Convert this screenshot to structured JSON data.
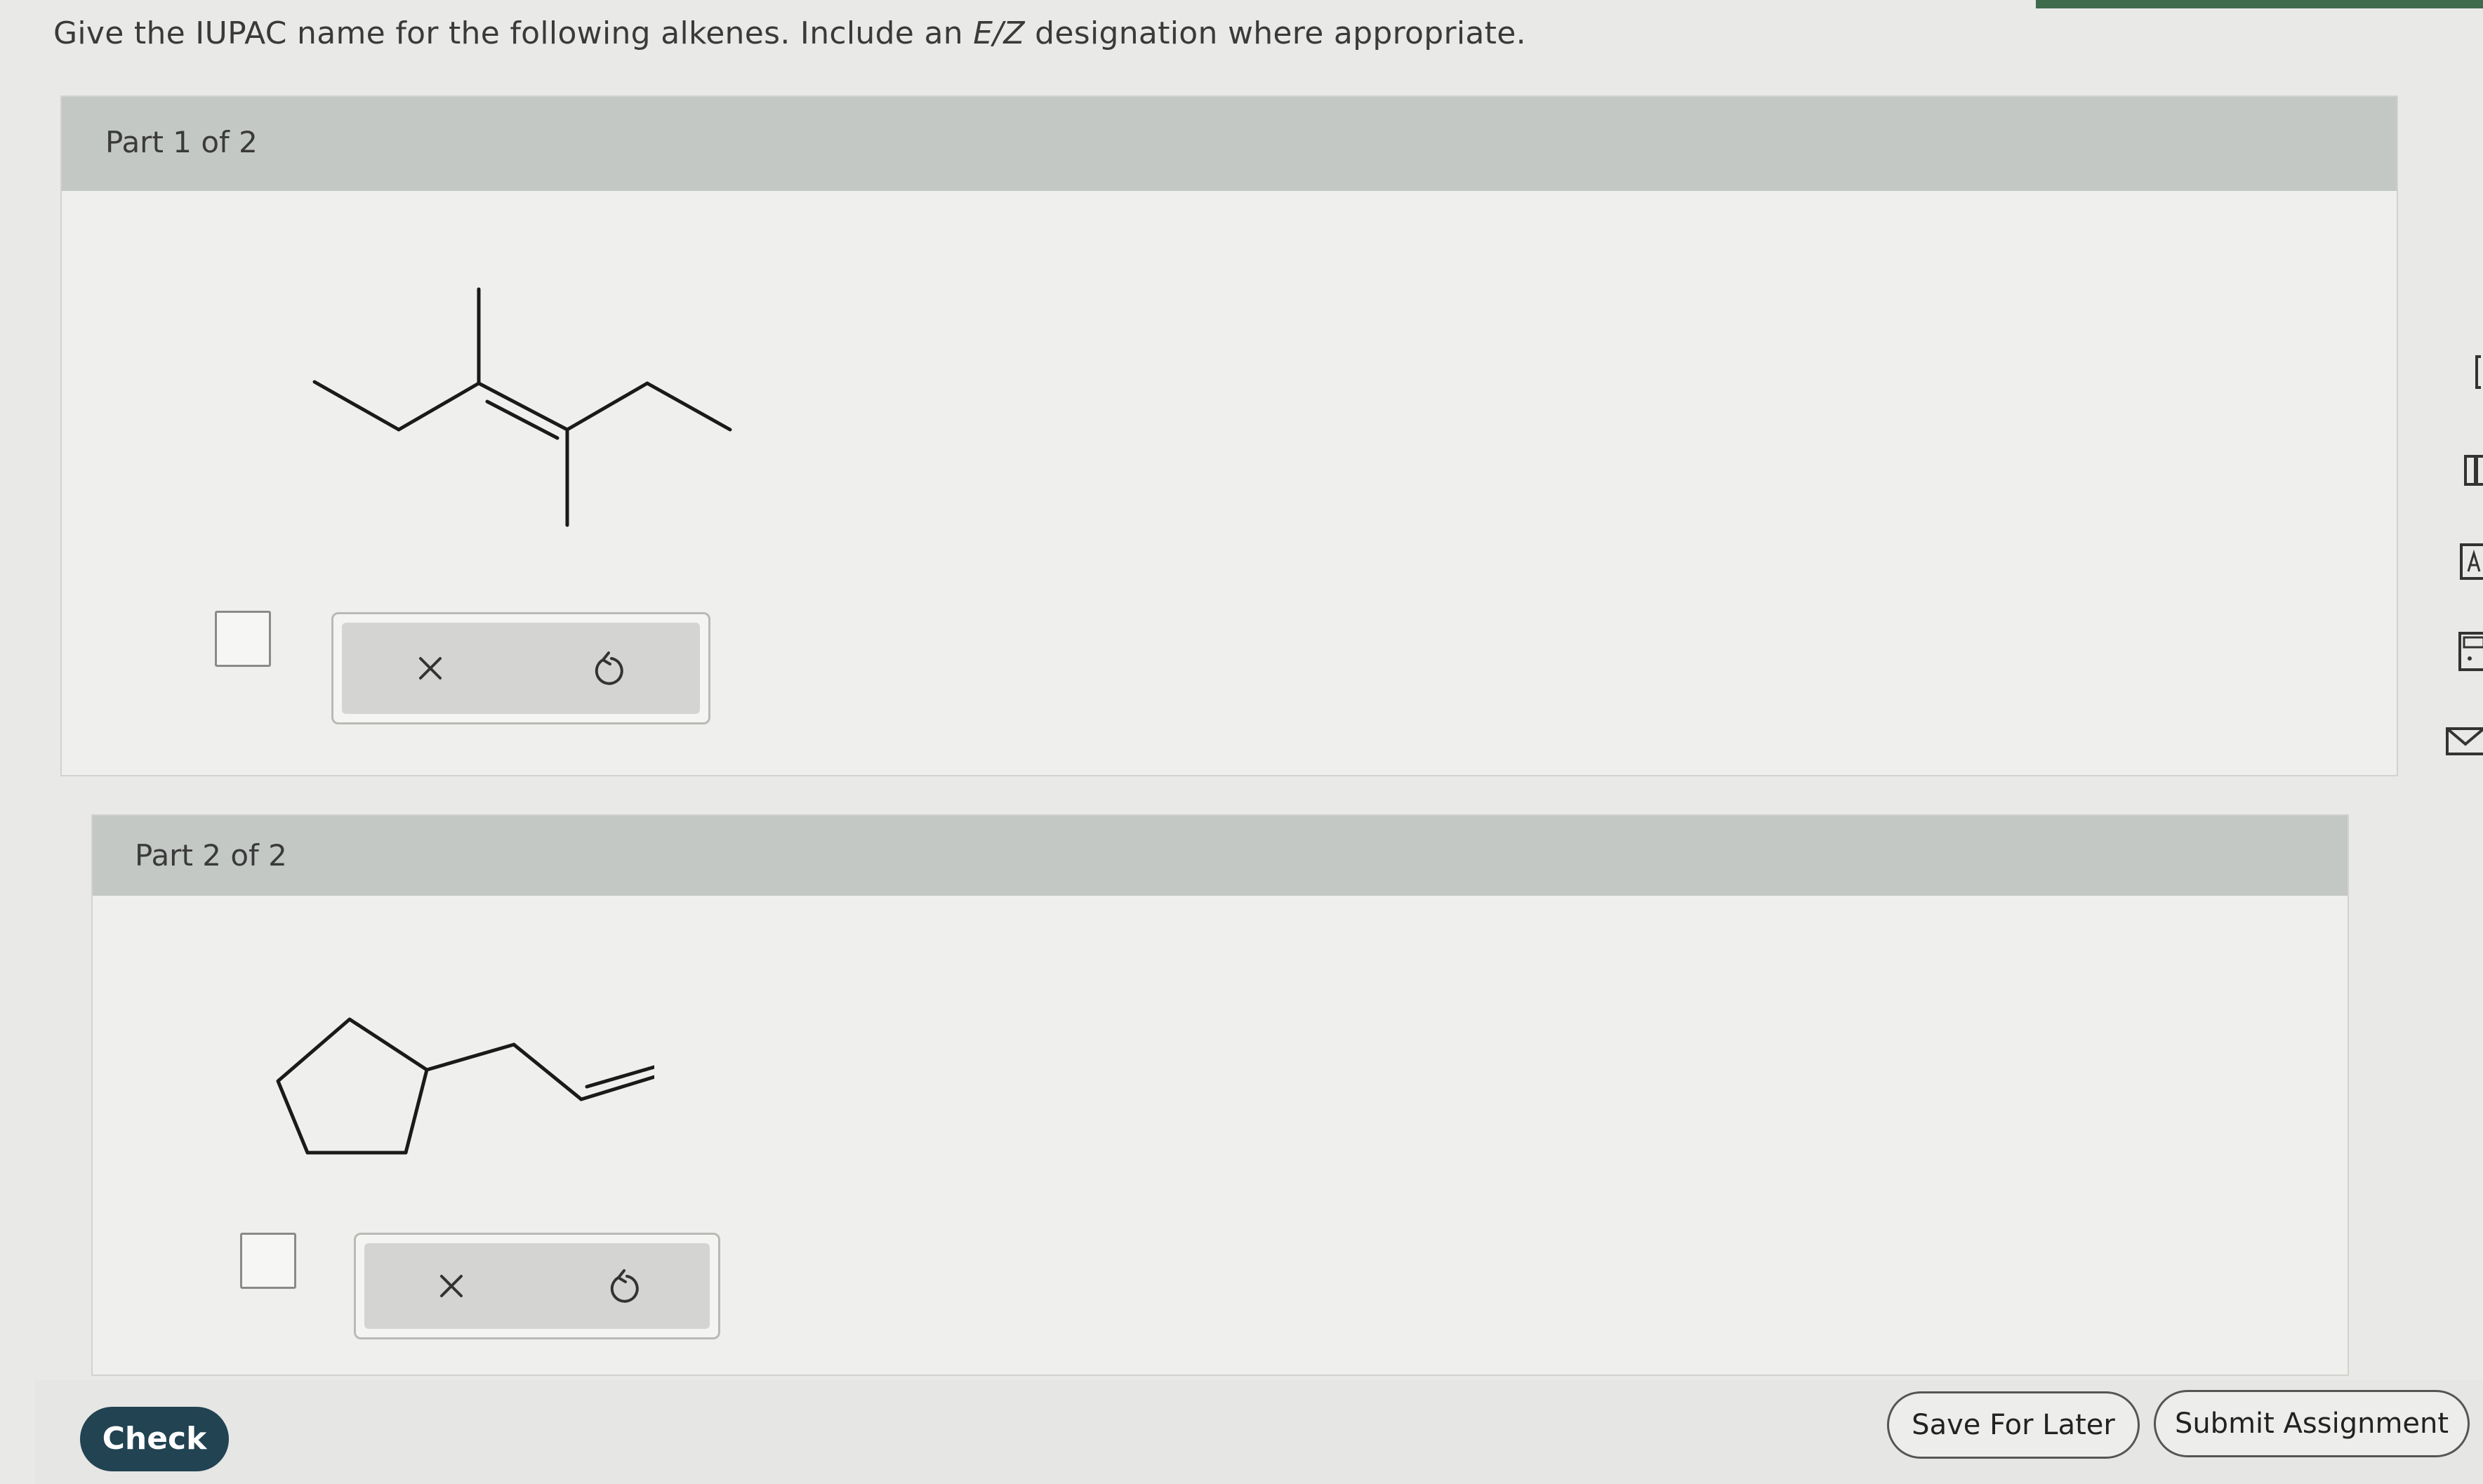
{
  "instructions": {
    "prefix": "Give the IUPAC name for the following alkenes. Include an ",
    "ez": "E/Z",
    "suffix": " designation where appropriate."
  },
  "parts": [
    {
      "label": "Part 1 of 2",
      "answer_value": ""
    },
    {
      "label": "Part 2 of 2",
      "answer_value": ""
    }
  ],
  "tools": {
    "clear_icon": "close-icon",
    "undo_icon": "undo-icon"
  },
  "footer": {
    "check_label": "Check",
    "save_label": "Save For Later",
    "submit_label": "Submit Assignment"
  },
  "colors": {
    "check_bg": "#214352",
    "header_bg": "#c4c8c5",
    "accent": "#3f6b4d"
  }
}
